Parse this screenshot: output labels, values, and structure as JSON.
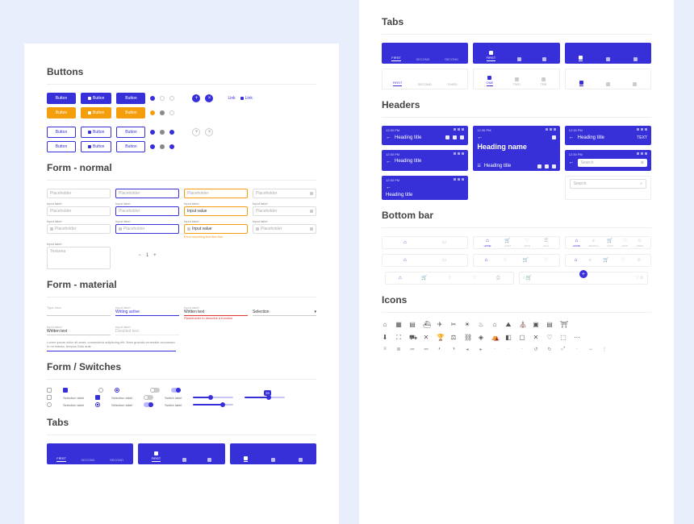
{
  "colors": {
    "primary": "#3730d8",
    "accent": "#f59e0b",
    "background": "#e9eefc"
  },
  "sections": {
    "buttons": "Buttons",
    "form_normal": "Form - normal",
    "form_material": "Form - material",
    "form_switches": "Form / Switches",
    "tabs": "Tabs",
    "headers": "Headers",
    "bottombar": "Bottom bar",
    "icons": "Icons"
  },
  "buttons": {
    "label": "Button",
    "link_label": "Link",
    "plus_glyph": "+",
    "close_glyph": "×"
  },
  "form": {
    "placeholder": "Placeholder",
    "input_label": "Input label",
    "input_value": "Input value",
    "textarea": "Textarea",
    "stepper_value": "1",
    "helper_error": "Error reporting text like this"
  },
  "material": {
    "type_here": "Type here",
    "writing_active": "Writing active",
    "written_text": "Written text",
    "selection": "Selection",
    "disabled_text": "Disabled text",
    "placeholder_error": "Placeholder to describe a function",
    "lorem": "Lorem ipsum dolor sit amet, consectetur adipiscing elit. Nam gravida venenatis  accumsan. In mi massa, tempus Duis aute"
  },
  "switches": {
    "selection_label": "Selection label",
    "switch_label": "Switch label",
    "slider_badge": "50"
  },
  "tabs": {
    "first": "FIRST",
    "second": "SECOND",
    "third": "THIRD",
    "one": "ONE",
    "two": "TWO",
    "tre": "TRE"
  },
  "headers": {
    "time": "12:30 PM",
    "heading_title": "Heading title",
    "heading_name": "Heading name",
    "search": "Search",
    "text_action": "TEXT"
  },
  "bottombar": {
    "home": "Home",
    "labels": [
      "HOME",
      "SEARCH",
      "CART",
      "FAVS",
      "USER"
    ]
  },
  "icons_row1": [
    "⌂",
    "▦",
    "▤",
    "⛴",
    "✈",
    "✂",
    "☀",
    "♨",
    "⌂",
    "⛰",
    "⛪",
    "▣",
    "▤",
    "⛩"
  ],
  "icons_row2": [
    "⬇",
    "⛶",
    "⛟",
    "✕",
    "🏆",
    "⚖",
    "⛓",
    "◈",
    "⛺",
    "◧",
    "▢",
    "✕",
    "♡",
    "⬚",
    "⋯"
  ],
  "icons_row3": [
    "≡",
    "≣",
    "≔",
    "≕",
    "◐",
    "◑",
    "◂",
    "▸",
    "·",
    "·",
    "·",
    "↺",
    "↻",
    "⤢",
    "·",
    "↔",
    "⋮"
  ]
}
